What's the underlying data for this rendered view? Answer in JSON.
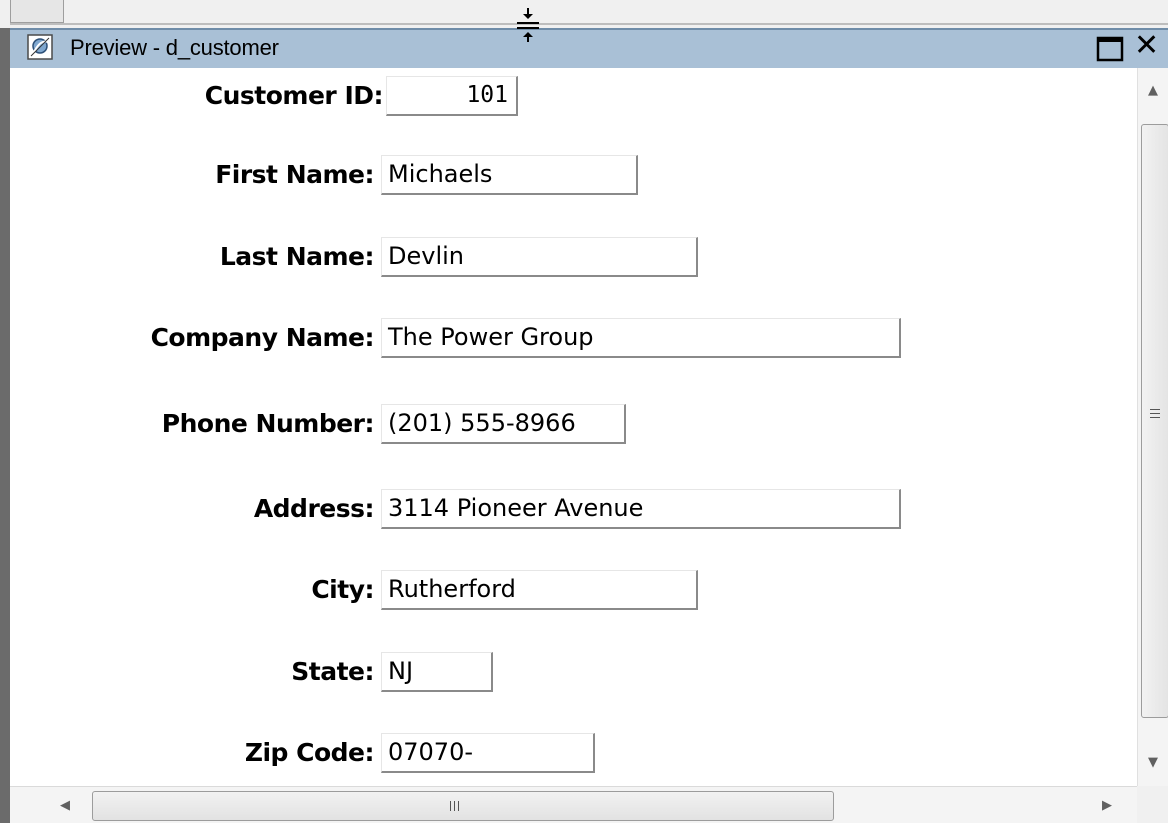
{
  "window": {
    "title": "Preview - d_customer"
  },
  "form": {
    "fields": [
      {
        "label": "Customer ID:",
        "value": "101"
      },
      {
        "label": "First Name:",
        "value": "Michaels"
      },
      {
        "label": "Last Name:",
        "value": "Devlin"
      },
      {
        "label": "Company Name:",
        "value": "The Power Group"
      },
      {
        "label": "Phone Number:",
        "value": "(201) 555-8966"
      },
      {
        "label": "Address:",
        "value": "3114 Pioneer Avenue"
      },
      {
        "label": "City:",
        "value": "Rutherford"
      },
      {
        "label": "State:",
        "value": "NJ"
      },
      {
        "label": "Zip Code:",
        "value": "07070-"
      }
    ]
  },
  "icons": {
    "title": "preview-window-icon",
    "maximize": "maximize-icon",
    "close": "close-icon",
    "splitter": "split-pane-icon"
  }
}
